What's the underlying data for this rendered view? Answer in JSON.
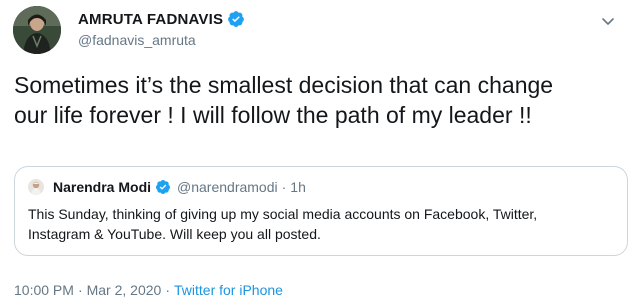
{
  "author": {
    "display_name": "AMRUTA FADNAVIS",
    "handle": "@fadnavis_amruta",
    "verified": true
  },
  "tweet": {
    "text_line1": "Sometimes it’s the smallest decision that can change",
    "text_line2": "our life forever ! I will follow the path of my leader !!"
  },
  "quoted_tweet": {
    "display_name": "Narendra Modi",
    "handle": "@narendramodi",
    "separator": "·",
    "time_ago": "1h",
    "text_line1": "This Sunday, thinking of giving up my social media accounts on Facebook, Twitter,",
    "text_line2": "Instagram & YouTube. Will keep you all posted."
  },
  "meta": {
    "time": "10:00 PM",
    "separator": "·",
    "date": "Mar 2, 2020",
    "source": "Twitter for iPhone"
  },
  "colors": {
    "verified_blue": "#1da1f2",
    "link_blue": "#1b95e0",
    "secondary_text": "#657786",
    "border": "#ccd6dd"
  },
  "icons": {
    "verified": "verified-badge-icon",
    "more": "chevron-down-icon"
  }
}
